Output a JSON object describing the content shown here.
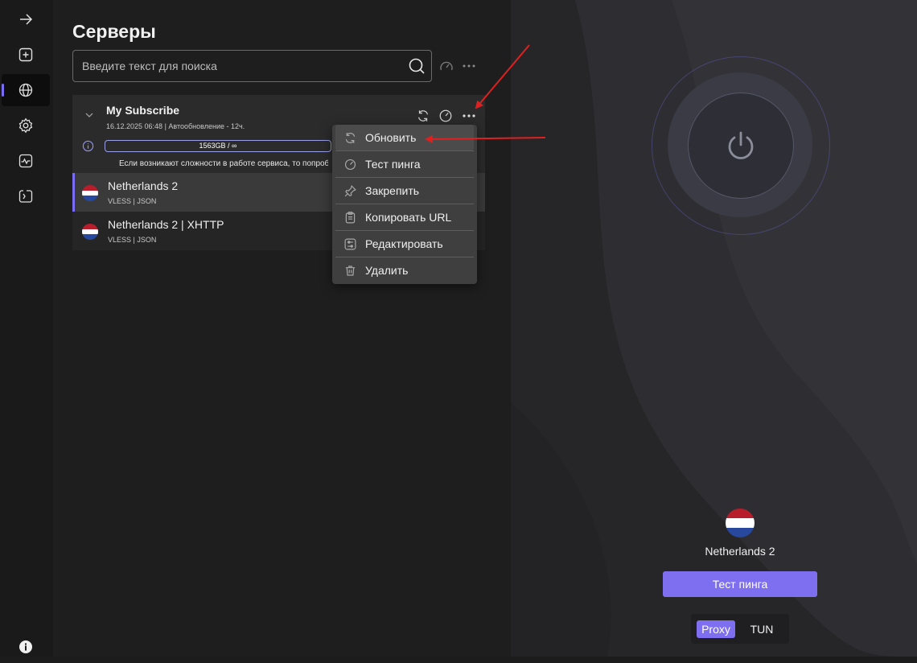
{
  "sidebar": {
    "items": [
      {
        "icon": "arrow-right-icon"
      },
      {
        "icon": "add-square-icon"
      },
      {
        "icon": "globe-icon",
        "active": true
      },
      {
        "icon": "gear-icon"
      },
      {
        "icon": "activity-icon"
      },
      {
        "icon": "code-icon"
      }
    ],
    "bottom_icon": "info-icon"
  },
  "main": {
    "title": "Серверы",
    "search": {
      "placeholder": "Введите текст для поиска",
      "value": ""
    }
  },
  "group": {
    "name": "My Subscribe",
    "meta": "16.12.2025 06:48 | Автообновление - 12ч.",
    "traffic": "1563GB / ∞",
    "notice": "Если возникают сложности в работе сервиса, то попробуйте",
    "servers": [
      {
        "name": "Netherlands 2",
        "type": "VLESS | JSON",
        "selected": true
      },
      {
        "name": "Netherlands 2 | XHTTP",
        "type": "VLESS | JSON",
        "selected": false
      }
    ]
  },
  "context_menu": {
    "items": [
      {
        "label": "Обновить",
        "icon": "refresh-icon"
      },
      {
        "label": "Тест пинга",
        "icon": "speedometer-icon"
      },
      {
        "label": "Закрепить",
        "icon": "pin-icon"
      },
      {
        "label": "Копировать URL",
        "icon": "clipboard-icon"
      },
      {
        "label": "Редактировать",
        "icon": "edit-icon"
      },
      {
        "label": "Удалить",
        "icon": "trash-icon"
      }
    ]
  },
  "right": {
    "selected_server": "Netherlands 2",
    "ping_button": "Тест пинга",
    "mode": {
      "proxy": "Proxy",
      "tun": "TUN",
      "active": "Proxy"
    }
  },
  "colors": {
    "accent": "#7e6ff0",
    "annotation": "#e02020"
  }
}
